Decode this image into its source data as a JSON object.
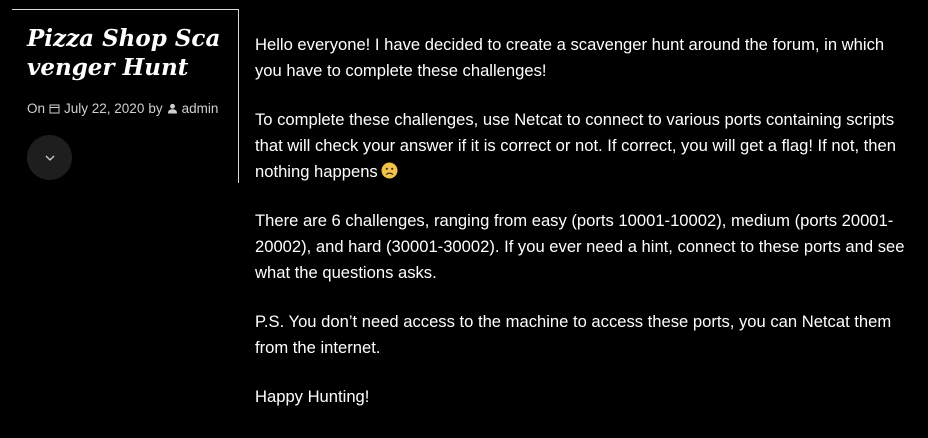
{
  "post": {
    "title": "Pizza Shop Scavenger Hunt",
    "meta": {
      "on_label": "On",
      "date": "July 22, 2020",
      "by_label": "by",
      "author": "admin"
    },
    "toggle_icon": "chevron-down-icon",
    "paragraphs": [
      "Hello everyone! I have decided to create a scavenger hunt around the forum, in which you have to complete these challenges!",
      "To complete these challenges, use Netcat to connect to various ports containing scripts that will check your answer if it is correct or not. If correct, you will get a flag! If not, then nothing happens",
      "There are 6 challenges, ranging from easy (ports 10001-10002), medium (ports 20001-20002), and hard (30001-30002). If you ever need a hint, connect to these ports and see what the questions asks.",
      "P.S. You don’t need access to the machine to access these ports, you can Netcat them from the internet.",
      "Happy Hunting!"
    ]
  },
  "colors": {
    "background": "#000000",
    "text": "#ffffff",
    "meta_text": "#cfcfcf",
    "border": "#d9d9d9",
    "button_bg": "#1e1e1e",
    "emoji": "#f2c34b"
  }
}
